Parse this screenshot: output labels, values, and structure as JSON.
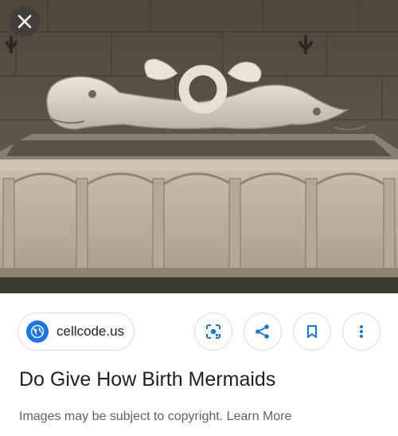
{
  "image": {
    "description_icon": "photo-content"
  },
  "controls": {
    "close_icon": "close-icon"
  },
  "source": {
    "domain": "cellcode.us",
    "icon": "globe-icon"
  },
  "actions": {
    "lens_icon": "lens-icon",
    "share_icon": "share-icon",
    "save_icon": "bookmark-icon",
    "more_icon": "more-vert-icon"
  },
  "result": {
    "title": "Do Give How Birth Mermaids"
  },
  "footer": {
    "notice": "Images may be subject to copyright.",
    "learn_more": "Learn More"
  },
  "colors": {
    "accent": "#1a73e8",
    "text": "#202124",
    "muted": "#5f6368",
    "border": "#dadce0"
  }
}
